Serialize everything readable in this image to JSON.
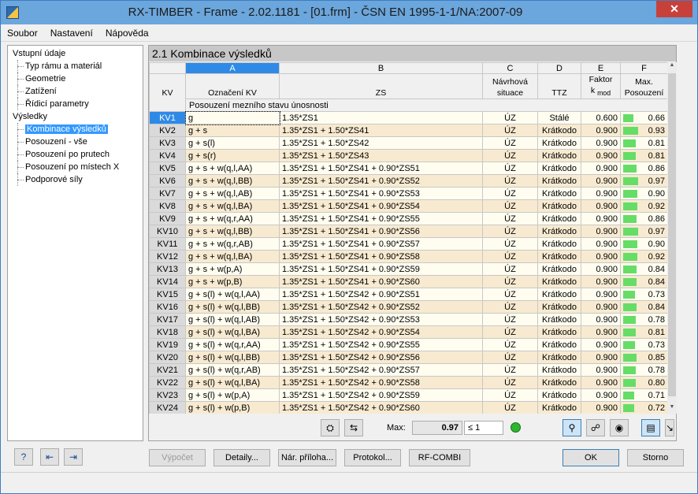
{
  "window": {
    "title": "RX-TIMBER - Frame - 2.02.1181 - [01.frm] - ČSN EN 1995-1-1/NA:2007-09",
    "close_glyph": "✕"
  },
  "menu": [
    "Soubor",
    "Nastavení",
    "Nápověda"
  ],
  "nav": {
    "input_group": "Vstupní údaje",
    "input_items": [
      "Typ rámu a materiál",
      "Geometrie",
      "Zatížení",
      "Řídicí parametry"
    ],
    "results_group": "Výsledky",
    "results_items": [
      "Kombinace výsledků",
      "Posouzení - vše",
      "Posouzení po prutech",
      "Posouzení po místech X",
      "Podporové síly"
    ],
    "selected": "Kombinace výsledků"
  },
  "section_title": "2.1 Kombinace výsledků",
  "table": {
    "col_letters": [
      "A",
      "B",
      "C",
      "D",
      "E",
      "F"
    ],
    "row_header_label": "KV",
    "headers": {
      "a": "Označení KV",
      "b": "ZS",
      "c1": "Návrhová",
      "c2": "situace",
      "d": "TTZ",
      "e1": "Faktor",
      "e2": "k",
      "e2sub": "mod",
      "f1": "Max.",
      "f2": "Posouzení"
    },
    "group_label": "Posouzení mezního stavu únosnosti",
    "rows": [
      {
        "kv": "KV1",
        "name": "g",
        "zs": "1.35*ZS1",
        "sit": "ÚZ",
        "ttz": "Stálé",
        "k": "0.600",
        "max": "0.66",
        "frac": 0.66
      },
      {
        "kv": "KV2",
        "name": "g + s",
        "zs": "1.35*ZS1 + 1.50*ZS41",
        "sit": "ÚZ",
        "ttz": "Krátkodo",
        "k": "0.900",
        "max": "0.93",
        "frac": 0.93
      },
      {
        "kv": "KV3",
        "name": "g + s(l)",
        "zs": "1.35*ZS1 + 1.50*ZS42",
        "sit": "ÚZ",
        "ttz": "Krátkodo",
        "k": "0.900",
        "max": "0.81",
        "frac": 0.81
      },
      {
        "kv": "KV4",
        "name": "g + s(r)",
        "zs": "1.35*ZS1 + 1.50*ZS43",
        "sit": "ÚZ",
        "ttz": "Krátkodo",
        "k": "0.900",
        "max": "0.81",
        "frac": 0.81
      },
      {
        "kv": "KV5",
        "name": "g + s + w(q,l,AA)",
        "zs": "1.35*ZS1 + 1.50*ZS41 + 0.90*ZS51",
        "sit": "ÚZ",
        "ttz": "Krátkodo",
        "k": "0.900",
        "max": "0.86",
        "frac": 0.86
      },
      {
        "kv": "KV6",
        "name": "g + s + w(q,l,BB)",
        "zs": "1.35*ZS1 + 1.50*ZS41 + 0.90*ZS52",
        "sit": "ÚZ",
        "ttz": "Krátkodo",
        "k": "0.900",
        "max": "0.97",
        "frac": 0.97
      },
      {
        "kv": "KV7",
        "name": "g + s + w(q,l,AB)",
        "zs": "1.35*ZS1 + 1.50*ZS41 + 0.90*ZS53",
        "sit": "ÚZ",
        "ttz": "Krátkodo",
        "k": "0.900",
        "max": "0.90",
        "frac": 0.9
      },
      {
        "kv": "KV8",
        "name": "g + s + w(q,l,BA)",
        "zs": "1.35*ZS1 + 1.50*ZS41 + 0.90*ZS54",
        "sit": "ÚZ",
        "ttz": "Krátkodo",
        "k": "0.900",
        "max": "0.92",
        "frac": 0.92
      },
      {
        "kv": "KV9",
        "name": "g + s + w(q,r,AA)",
        "zs": "1.35*ZS1 + 1.50*ZS41 + 0.90*ZS55",
        "sit": "ÚZ",
        "ttz": "Krátkodo",
        "k": "0.900",
        "max": "0.86",
        "frac": 0.86
      },
      {
        "kv": "KV10",
        "name": "g + s + w(q,l,BB)",
        "zs": "1.35*ZS1 + 1.50*ZS41 + 0.90*ZS56",
        "sit": "ÚZ",
        "ttz": "Krátkodo",
        "k": "0.900",
        "max": "0.97",
        "frac": 0.97
      },
      {
        "kv": "KV11",
        "name": "g + s + w(q,r,AB)",
        "zs": "1.35*ZS1 + 1.50*ZS41 + 0.90*ZS57",
        "sit": "ÚZ",
        "ttz": "Krátkodo",
        "k": "0.900",
        "max": "0.90",
        "frac": 0.9
      },
      {
        "kv": "KV12",
        "name": "g + s + w(q,l,BA)",
        "zs": "1.35*ZS1 + 1.50*ZS41 + 0.90*ZS58",
        "sit": "ÚZ",
        "ttz": "Krátkodo",
        "k": "0.900",
        "max": "0.92",
        "frac": 0.92
      },
      {
        "kv": "KV13",
        "name": "g + s + w(p,A)",
        "zs": "1.35*ZS1 + 1.50*ZS41 + 0.90*ZS59",
        "sit": "ÚZ",
        "ttz": "Krátkodo",
        "k": "0.900",
        "max": "0.84",
        "frac": 0.84
      },
      {
        "kv": "KV14",
        "name": "g + s + w(p,B)",
        "zs": "1.35*ZS1 + 1.50*ZS41 + 0.90*ZS60",
        "sit": "ÚZ",
        "ttz": "Krátkodo",
        "k": "0.900",
        "max": "0.84",
        "frac": 0.84
      },
      {
        "kv": "KV15",
        "name": "g + s(l) + w(q,l,AA)",
        "zs": "1.35*ZS1 + 1.50*ZS42 + 0.90*ZS51",
        "sit": "ÚZ",
        "ttz": "Krátkodo",
        "k": "0.900",
        "max": "0.73",
        "frac": 0.73
      },
      {
        "kv": "KV16",
        "name": "g + s(l) + w(q,l,BB)",
        "zs": "1.35*ZS1 + 1.50*ZS42 + 0.90*ZS52",
        "sit": "ÚZ",
        "ttz": "Krátkodo",
        "k": "0.900",
        "max": "0.84",
        "frac": 0.84
      },
      {
        "kv": "KV17",
        "name": "g + s(l) + w(q,l,AB)",
        "zs": "1.35*ZS1 + 1.50*ZS42 + 0.90*ZS53",
        "sit": "ÚZ",
        "ttz": "Krátkodo",
        "k": "0.900",
        "max": "0.78",
        "frac": 0.78
      },
      {
        "kv": "KV18",
        "name": "g + s(l) + w(q,l,BA)",
        "zs": "1.35*ZS1 + 1.50*ZS42 + 0.90*ZS54",
        "sit": "ÚZ",
        "ttz": "Krátkodo",
        "k": "0.900",
        "max": "0.81",
        "frac": 0.81
      },
      {
        "kv": "KV19",
        "name": "g + s(l) + w(q,r,AA)",
        "zs": "1.35*ZS1 + 1.50*ZS42 + 0.90*ZS55",
        "sit": "ÚZ",
        "ttz": "Krátkodo",
        "k": "0.900",
        "max": "0.73",
        "frac": 0.73
      },
      {
        "kv": "KV20",
        "name": "g + s(l) + w(q,l,BB)",
        "zs": "1.35*ZS1 + 1.50*ZS42 + 0.90*ZS56",
        "sit": "ÚZ",
        "ttz": "Krátkodo",
        "k": "0.900",
        "max": "0.85",
        "frac": 0.85
      },
      {
        "kv": "KV21",
        "name": "g + s(l) + w(q,r,AB)",
        "zs": "1.35*ZS1 + 1.50*ZS42 + 0.90*ZS57",
        "sit": "ÚZ",
        "ttz": "Krátkodo",
        "k": "0.900",
        "max": "0.78",
        "frac": 0.78
      },
      {
        "kv": "KV22",
        "name": "g + s(l) + w(q,l,BA)",
        "zs": "1.35*ZS1 + 1.50*ZS42 + 0.90*ZS58",
        "sit": "ÚZ",
        "ttz": "Krátkodo",
        "k": "0.900",
        "max": "0.80",
        "frac": 0.8
      },
      {
        "kv": "KV23",
        "name": "g + s(l) + w(p,A)",
        "zs": "1.35*ZS1 + 1.50*ZS42 + 0.90*ZS59",
        "sit": "ÚZ",
        "ttz": "Krátkodo",
        "k": "0.900",
        "max": "0.71",
        "frac": 0.71
      },
      {
        "kv": "KV24",
        "name": "g + s(l) + w(p,B)",
        "zs": "1.35*ZS1 + 1.50*ZS42 + 0.90*ZS60",
        "sit": "ÚZ",
        "ttz": "Krátkodo",
        "k": "0.900",
        "max": "0.72",
        "frac": 0.72
      }
    ]
  },
  "max_bar": {
    "label": "Max:",
    "value": "0.97",
    "criterion": "≤ 1"
  },
  "buttons": {
    "calculate": "Výpočet",
    "details": "Detaily...",
    "national_annex": "Nár. příloha...",
    "protocol": "Protokol...",
    "rf_combi": "RF-COMBI",
    "ok": "OK",
    "cancel": "Storno"
  },
  "colors": {
    "accent": "#2e8ae6",
    "bar": "#66dd66",
    "titlebar": "#6ba6dc"
  }
}
